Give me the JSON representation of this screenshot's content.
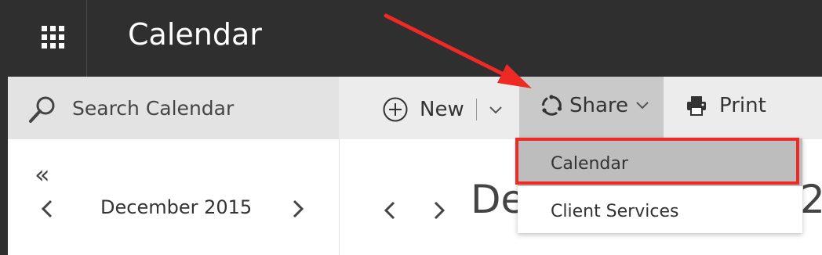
{
  "app": {
    "title": "Calendar"
  },
  "search": {
    "placeholder": "Search Calendar"
  },
  "toolbar": {
    "new_label": "New",
    "share_label": "Share",
    "print_label": "Print"
  },
  "share_menu": {
    "items": [
      {
        "label": "Calendar",
        "highlighted": true
      },
      {
        "label": "Client Services",
        "highlighted": false
      }
    ]
  },
  "mini_calendar": {
    "month": "December 2015"
  },
  "main_view": {
    "date_prefix": "De",
    "date_suffix": "2"
  },
  "colors": {
    "topbar": "#2f2f2f",
    "share_active": "#c9c9c9",
    "menu_highlight": "#bdbdbd",
    "annotation_red": "#ee2a24"
  },
  "icons": [
    "waffle-icon",
    "search-icon",
    "plus-circle-icon",
    "chevron-down-icon",
    "share-icon",
    "print-icon",
    "double-chevron-left-icon",
    "chevron-left-icon",
    "chevron-right-icon"
  ]
}
